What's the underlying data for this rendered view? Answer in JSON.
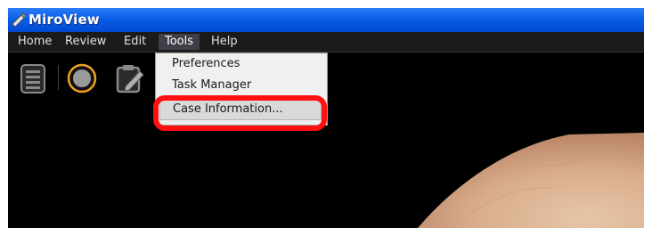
{
  "app": {
    "title": "MiroView",
    "icon": "pencil-icon"
  },
  "menubar": {
    "items": [
      {
        "label": "Home"
      },
      {
        "label": "Review"
      },
      {
        "label": "Edit"
      },
      {
        "label": "Tools",
        "active": true
      },
      {
        "label": "Help"
      }
    ]
  },
  "toolbar": {
    "buttons": [
      {
        "icon": "list-document-icon"
      },
      {
        "icon": "record-circle-icon"
      },
      {
        "icon": "clipboard-edit-icon"
      }
    ]
  },
  "tools_menu": {
    "items": [
      {
        "label": "Preferences"
      },
      {
        "label": "Task Manager"
      },
      {
        "label": "Case Information...",
        "selected": true
      }
    ]
  },
  "colors": {
    "highlight": "#ff1010",
    "titlebar": "#0a5fe6",
    "menubar": "#1b1b1b",
    "accent_ring": "#f0a020"
  }
}
